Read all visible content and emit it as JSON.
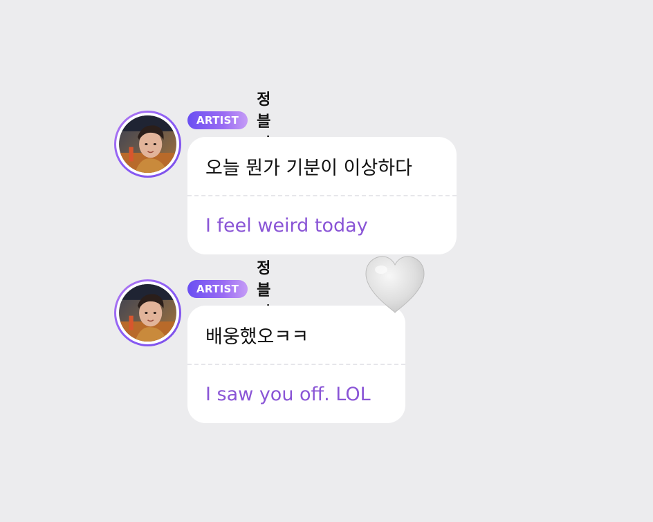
{
  "messages": [
    {
      "badge": "ARTIST",
      "name": "정블리",
      "original": "오늘 뭔가 기분이 이상하다",
      "translation": "I feel weird today"
    },
    {
      "badge": "ARTIST",
      "name": "정블리",
      "original": "배웅했오ㅋㅋ",
      "translation": "I saw you off. LOL"
    }
  ],
  "colors": {
    "background": "#ececee",
    "badge_start": "#6a4ff2",
    "badge_end": "#c59cf6",
    "translation_text": "#8a55d6",
    "avatar_ring": "#8a5cf5",
    "heart": "#dcdcdc"
  },
  "icons": {
    "reaction": "heart-icon"
  }
}
